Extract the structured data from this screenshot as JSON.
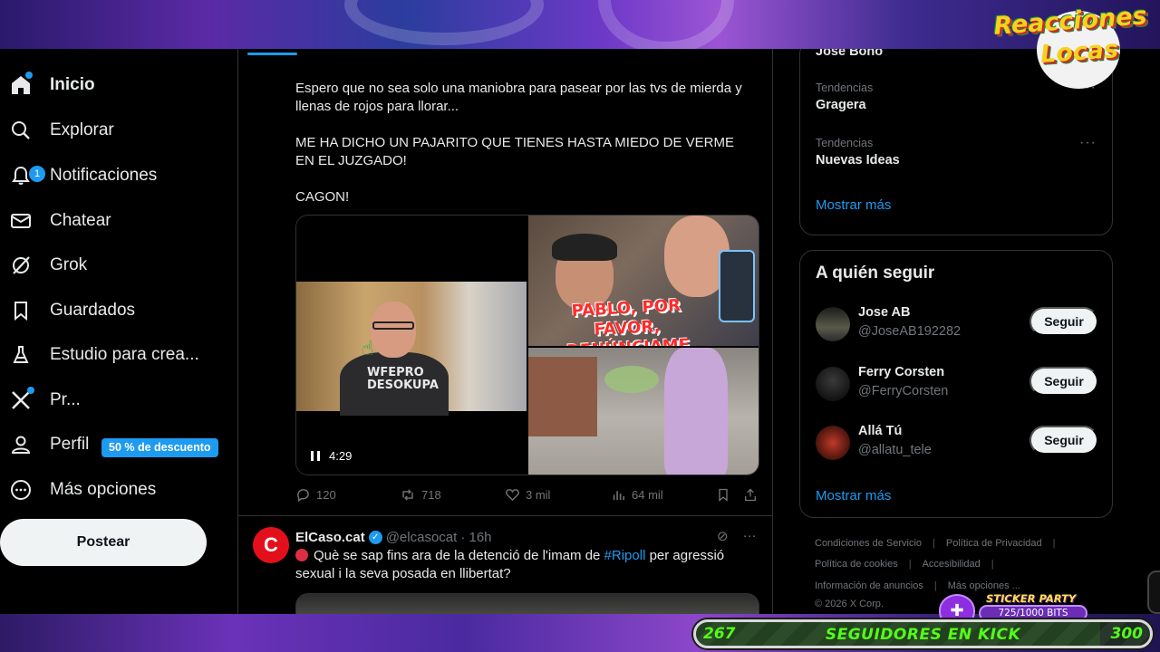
{
  "sidebar": {
    "items": [
      {
        "label": "Inicio",
        "icon": "home-icon"
      },
      {
        "label": "Explorar",
        "icon": "search-icon"
      },
      {
        "label": "Notificaciones",
        "icon": "bell-icon",
        "badge": "1"
      },
      {
        "label": "Chatear",
        "icon": "mail-icon"
      },
      {
        "label": "Grok",
        "icon": "grok-icon"
      },
      {
        "label": "Guardados",
        "icon": "bookmark-icon"
      },
      {
        "label": "Estudio para crea...",
        "icon": "flask-icon"
      },
      {
        "label": "Pr...",
        "icon": "x-logo-icon",
        "promo": "50 % de descuento"
      },
      {
        "label": "Perfil",
        "icon": "user-icon"
      },
      {
        "label": "Más opciones",
        "icon": "more-circle-icon"
      }
    ],
    "post_button": "Postear"
  },
  "tweet1": {
    "paragraphs": [
      "Espero que no sea solo una maniobra para pasear por las tvs de mierda y llenas de rojos para llorar...",
      "ME HA DICHO UN PAJARITO QUE TIENES HASTA MIEDO DE VERME EN EL JUZGADO!",
      "CAGON!"
    ],
    "video_duration": "4:29",
    "shirt_text": "WFEPRO DESOKUPA",
    "thumbnail_banner": "PABLO, POR FAVOR, DENÚNCIAME",
    "replies": "120",
    "reposts": "718",
    "likes": "3 mil",
    "views": "64 mil"
  },
  "tweet2": {
    "avatar_letter": "C",
    "name": "ElCaso.cat",
    "handle": "@elcasocat",
    "time": "· 16h",
    "text_before": "Què se sap fins ara de la detenció de l'imam de ",
    "hashtag": "#Ripoll",
    "text_after": " per agressió sexual i la seva posada en llibertat?"
  },
  "trends": {
    "top_partial": "Jose Bono",
    "items": [
      {
        "category": "Tendencias",
        "name": "Gragera"
      },
      {
        "category": "Tendencias",
        "name": "Nuevas Ideas"
      }
    ],
    "show_more": "Mostrar más"
  },
  "who_to_follow": {
    "title": "A quién seguir",
    "users": [
      {
        "name": "Jose AB",
        "handle": "@JoseAB192282",
        "button": "Seguir"
      },
      {
        "name": "Ferry Corsten",
        "handle": "@FerryCorsten",
        "button": "Seguir"
      },
      {
        "name": "Allá Tú",
        "handle": "@allatu_tele",
        "button": "Seguir"
      }
    ],
    "show_more": "Mostrar más"
  },
  "footer": {
    "links_row1": [
      "Condiciones de Servicio",
      "Política de Privacidad"
    ],
    "links_row2": [
      "Política de cookies",
      "Accesibilidad"
    ],
    "links_row3": [
      "Información de anuncios",
      "Más opciones ..."
    ],
    "copyright": "© 2026 X Corp."
  },
  "overlay": {
    "logo_line1": "Reacciones",
    "logo_line2": "Locas",
    "sticker_title": "STICKER PARTY",
    "sticker_progress": "725/1000 BITS",
    "follower_goal_label": "SEGUIDORES EN KICK",
    "follower_current": "267",
    "follower_target": "300",
    "follower_progress_fraction": 0.89
  },
  "colors": {
    "accent": "#1d9bf0",
    "text": "#e7e9ea",
    "muted": "#71767b",
    "kick_green": "#53fc18"
  }
}
